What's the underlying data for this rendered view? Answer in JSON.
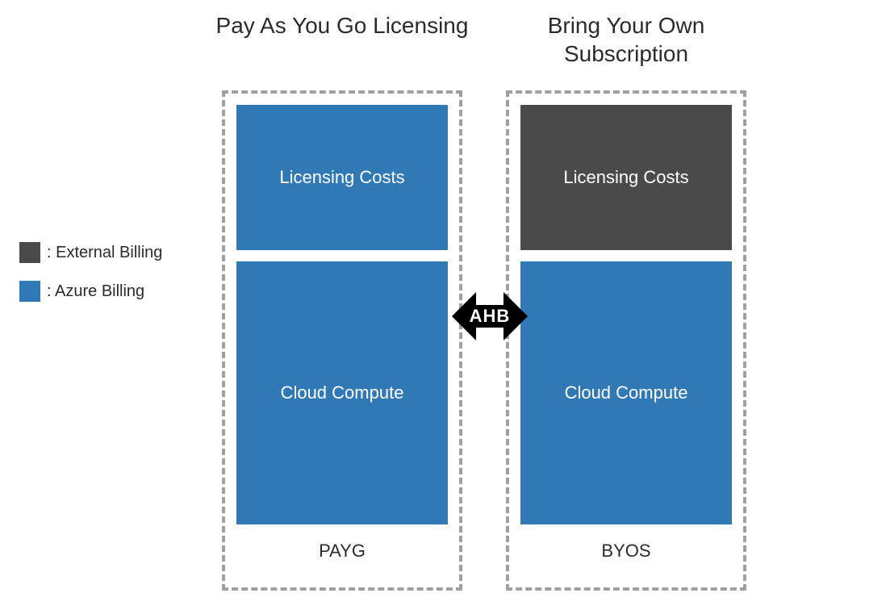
{
  "titles": {
    "left": "Pay As You Go Licensing",
    "right": "Bring Your Own Subscription"
  },
  "pillars": {
    "left": {
      "licensing": {
        "label": "Licensing Costs",
        "billing": "azure"
      },
      "compute": {
        "label": "Cloud Compute",
        "billing": "azure"
      },
      "footer": "PAYG"
    },
    "right": {
      "licensing": {
        "label": "Licensing Costs",
        "billing": "external"
      },
      "compute": {
        "label": "Cloud Compute",
        "billing": "azure"
      },
      "footer": "BYOS"
    }
  },
  "connector": {
    "label": "AHB",
    "direction": "bidirectional"
  },
  "legend": {
    "external": {
      "label": ": External Billing",
      "color": "#4a4a4a"
    },
    "azure": {
      "label": ": Azure Billing",
      "color": "#3179b4"
    }
  },
  "colors": {
    "azure": "#3179b4",
    "external": "#4a4a4a",
    "border": "#a0a0a0"
  }
}
